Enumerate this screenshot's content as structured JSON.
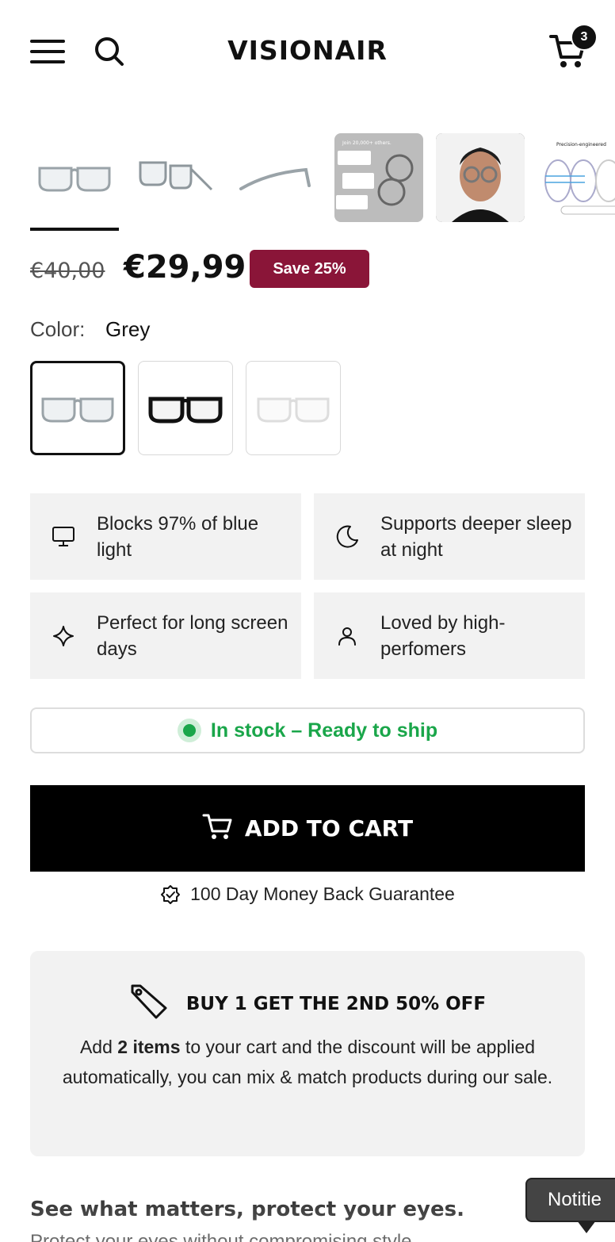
{
  "header": {
    "logo": "VISIONAIR",
    "cart_count": "3"
  },
  "gallery": {
    "thumbnails": [
      {
        "name": "front-view"
      },
      {
        "name": "angled-view"
      },
      {
        "name": "side-view"
      },
      {
        "name": "reviews-graphic",
        "caption": "Join 20,000+ others."
      },
      {
        "name": "model-photo"
      },
      {
        "name": "lens-graphic",
        "caption": "Precision-engineered with the best tech"
      }
    ]
  },
  "price": {
    "original": "€40,00",
    "current": "€29,99",
    "save_badge": "Save 25%"
  },
  "color": {
    "label": "Color:",
    "selected": "Grey",
    "swatches": [
      "grey",
      "black",
      "clear"
    ]
  },
  "features": [
    {
      "icon": "monitor-icon",
      "text": "Blocks 97% of blue light"
    },
    {
      "icon": "moon-icon",
      "text": "Supports deeper sleep at night"
    },
    {
      "icon": "sparkle-icon",
      "text": "Perfect for long screen days"
    },
    {
      "icon": "user-icon",
      "text": "Loved by high-perfomers"
    }
  ],
  "stock": {
    "text": "In stock – Ready to ship",
    "color": "#1aa64a"
  },
  "cta": {
    "add_to_cart": "ADD TO CART",
    "guarantee": "100 Day Money Back Guarantee"
  },
  "promo": {
    "title": "BUY 1 GET THE 2ND 50% OFF",
    "body_before": "Add ",
    "body_bold": "2 items",
    "body_after": " to your cart and the discount will be applied automatically, you can mix & match products during our sale."
  },
  "section": {
    "title": "See what matters, protect your eyes.",
    "partial_text": "Protect your eyes without compromising style"
  },
  "notice": {
    "label": "Notitie"
  },
  "colors": {
    "accent_badge": "#8a1538",
    "stock_green": "#1aa64a",
    "cta_bg": "#000000"
  }
}
